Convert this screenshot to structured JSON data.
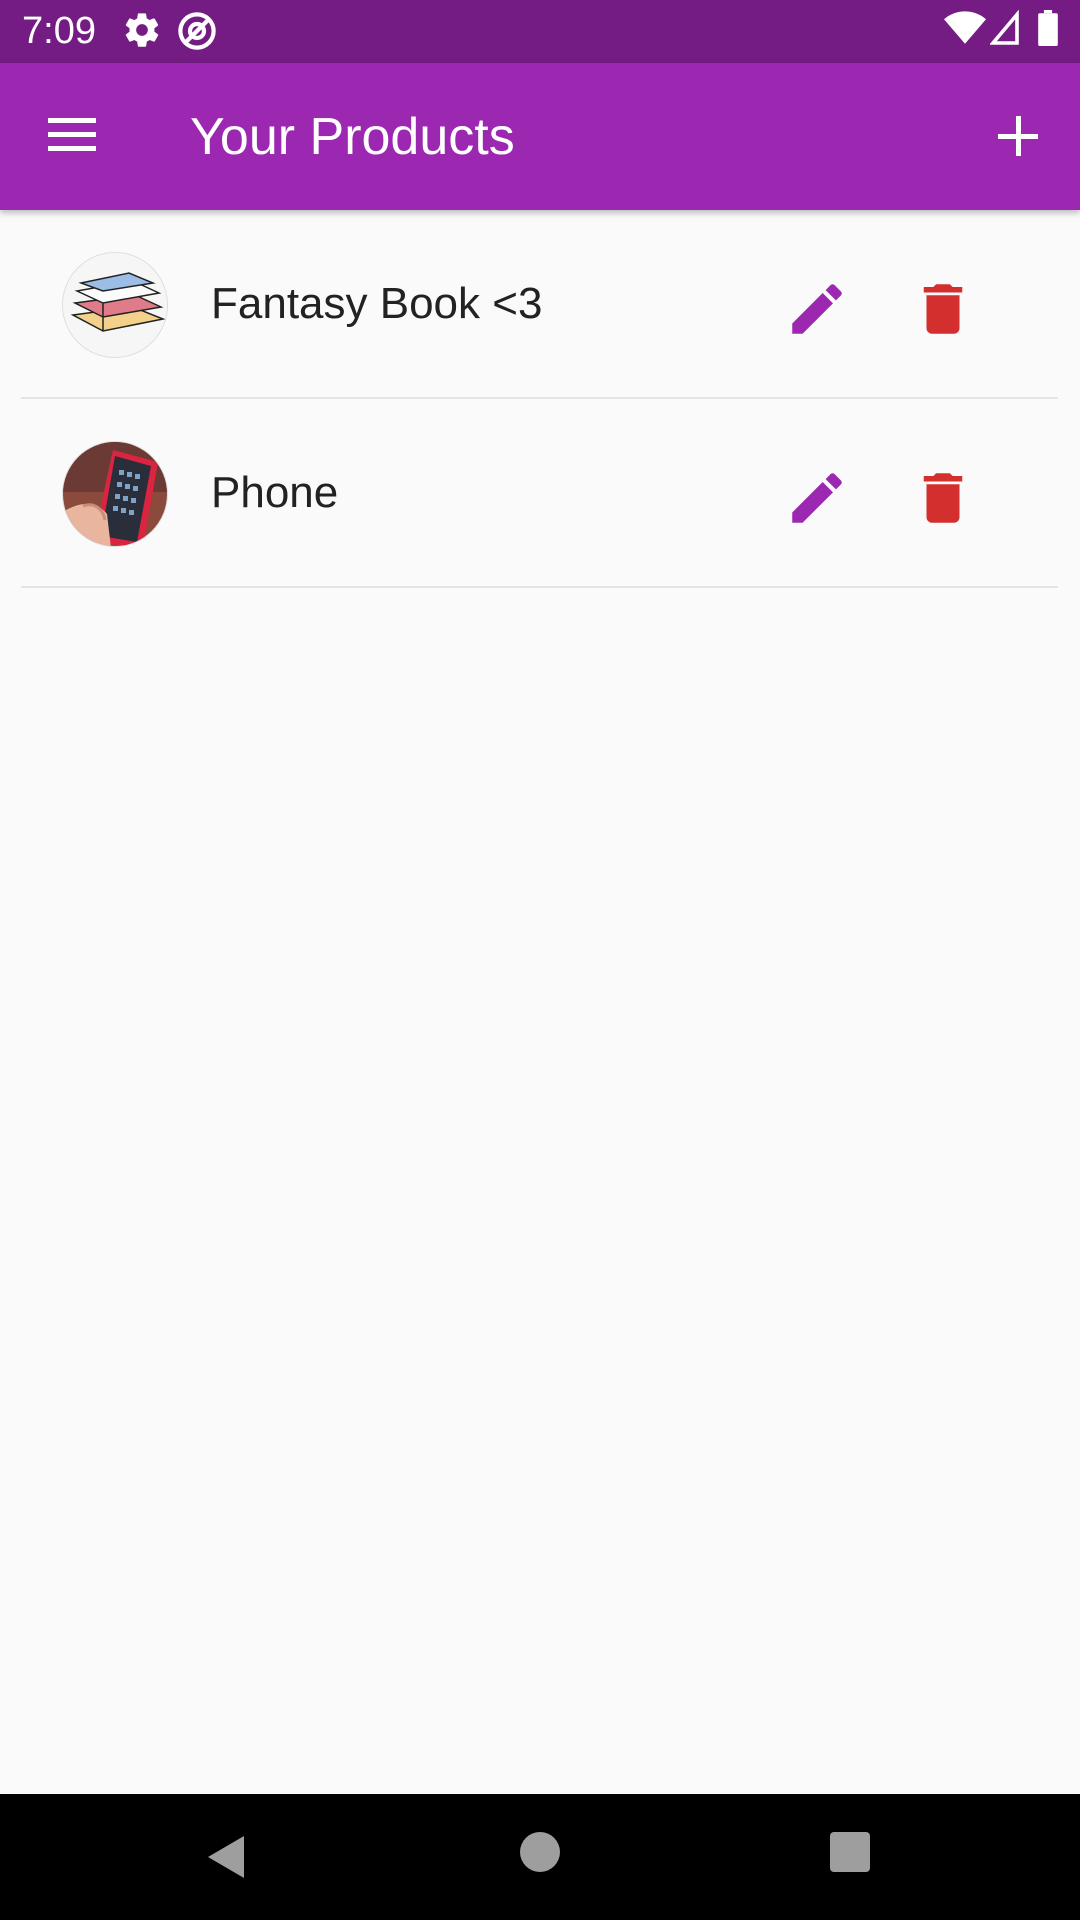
{
  "status_bar": {
    "time": "7:09",
    "icons": [
      "settings-gear-icon",
      "at-sign-icon",
      "wifi-icon",
      "cell-signal-icon",
      "battery-icon"
    ]
  },
  "app_bar": {
    "title": "Your Products",
    "menu_icon": "hamburger-menu-icon",
    "add_icon": "plus-icon"
  },
  "products": [
    {
      "title": "Fantasy Book <3",
      "image": "stack-of-books"
    },
    {
      "title": "Phone",
      "image": "hand-holding-phone"
    }
  ],
  "colors": {
    "primary": "#9c27b0",
    "status_bar": "#741c84",
    "edit_icon": "#9c27b0",
    "delete_icon": "#d32f2f",
    "background": "#fafafa"
  },
  "nav_bar": {
    "icons": [
      "back-triangle-icon",
      "home-circle-icon",
      "recents-square-icon"
    ]
  }
}
